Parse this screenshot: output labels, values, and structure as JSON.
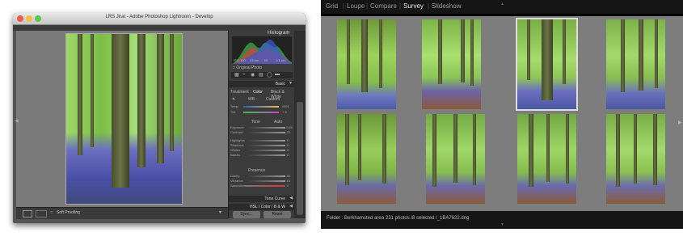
{
  "develop_window": {
    "title": "LRS Jirat - Adobe Photoshop Lightroom - Develop",
    "histogram_label": "Histogram",
    "histogram_info": [
      "ISO 100",
      "21mm",
      "f/8",
      "1/1 sec"
    ],
    "original_photo_label": "Original Photo",
    "basic_label": "Basic",
    "treatment_label": "Treatment :",
    "color_label": "Color",
    "bw_label": "Black & White",
    "wb_label": "WB :",
    "wb_value": "Custom",
    "temp_label": "Temp",
    "temp_value": "4991",
    "tint_label": "Tint",
    "tint_value": "+ 6",
    "tone_label": "Tone",
    "auto_label": "Auto",
    "tone_sliders": [
      {
        "label": "Exposure",
        "value": "+ 0.00"
      },
      {
        "label": "Contrast",
        "value": "+ 23"
      },
      {
        "label": "Highlights",
        "value": "0"
      },
      {
        "label": "Shadows",
        "value": "0"
      },
      {
        "label": "Whites",
        "value": "0"
      },
      {
        "label": "Blacks",
        "value": "0"
      }
    ],
    "presence_label": "Presence",
    "presence_sliders": [
      {
        "label": "Clarity",
        "value": "+ 45"
      },
      {
        "label": "Vibrance",
        "value": "+ 15"
      },
      {
        "label": "Saturation",
        "value": "0"
      }
    ],
    "tone_curve_label": "Tone Curve",
    "hsl_label": "HSL / Color / B & W",
    "soft_proofing_label": "Soft Proofing",
    "sync_label": "Sync...",
    "reset_label": "Reset"
  },
  "survey": {
    "nav": [
      "Grid",
      "Loupe",
      "Compare",
      "Survey",
      "Slideshow"
    ],
    "active_nav": "Survey",
    "folder_text": "Folder : Berkhamsted area",
    "count_text": "231 photos /8 selected /_1BA7622.dng",
    "thumb_count": 8
  }
}
